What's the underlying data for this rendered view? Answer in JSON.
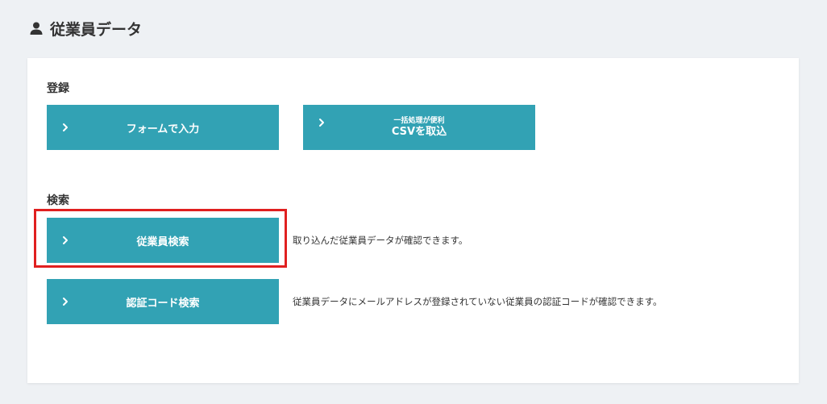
{
  "header": {
    "title": "従業員データ",
    "icon": "user-icon"
  },
  "sections": {
    "register": {
      "label": "登録",
      "form_button": {
        "label": "フォームで入力"
      },
      "csv_button": {
        "sub_label": "一括処理が便利",
        "label": "CSVを取込"
      }
    },
    "search": {
      "label": "検索",
      "employee_search": {
        "label": "従業員検索",
        "description": "取り込んだ従業員データが確認できます。"
      },
      "auth_code_search": {
        "label": "認証コード検索",
        "description": "従業員データにメールアドレスが登録されていない従業員の認証コードが確認できます。"
      }
    }
  },
  "colors": {
    "button_bg": "#32a2b4",
    "highlight": "#e02020",
    "page_bg": "#eef1f4"
  }
}
